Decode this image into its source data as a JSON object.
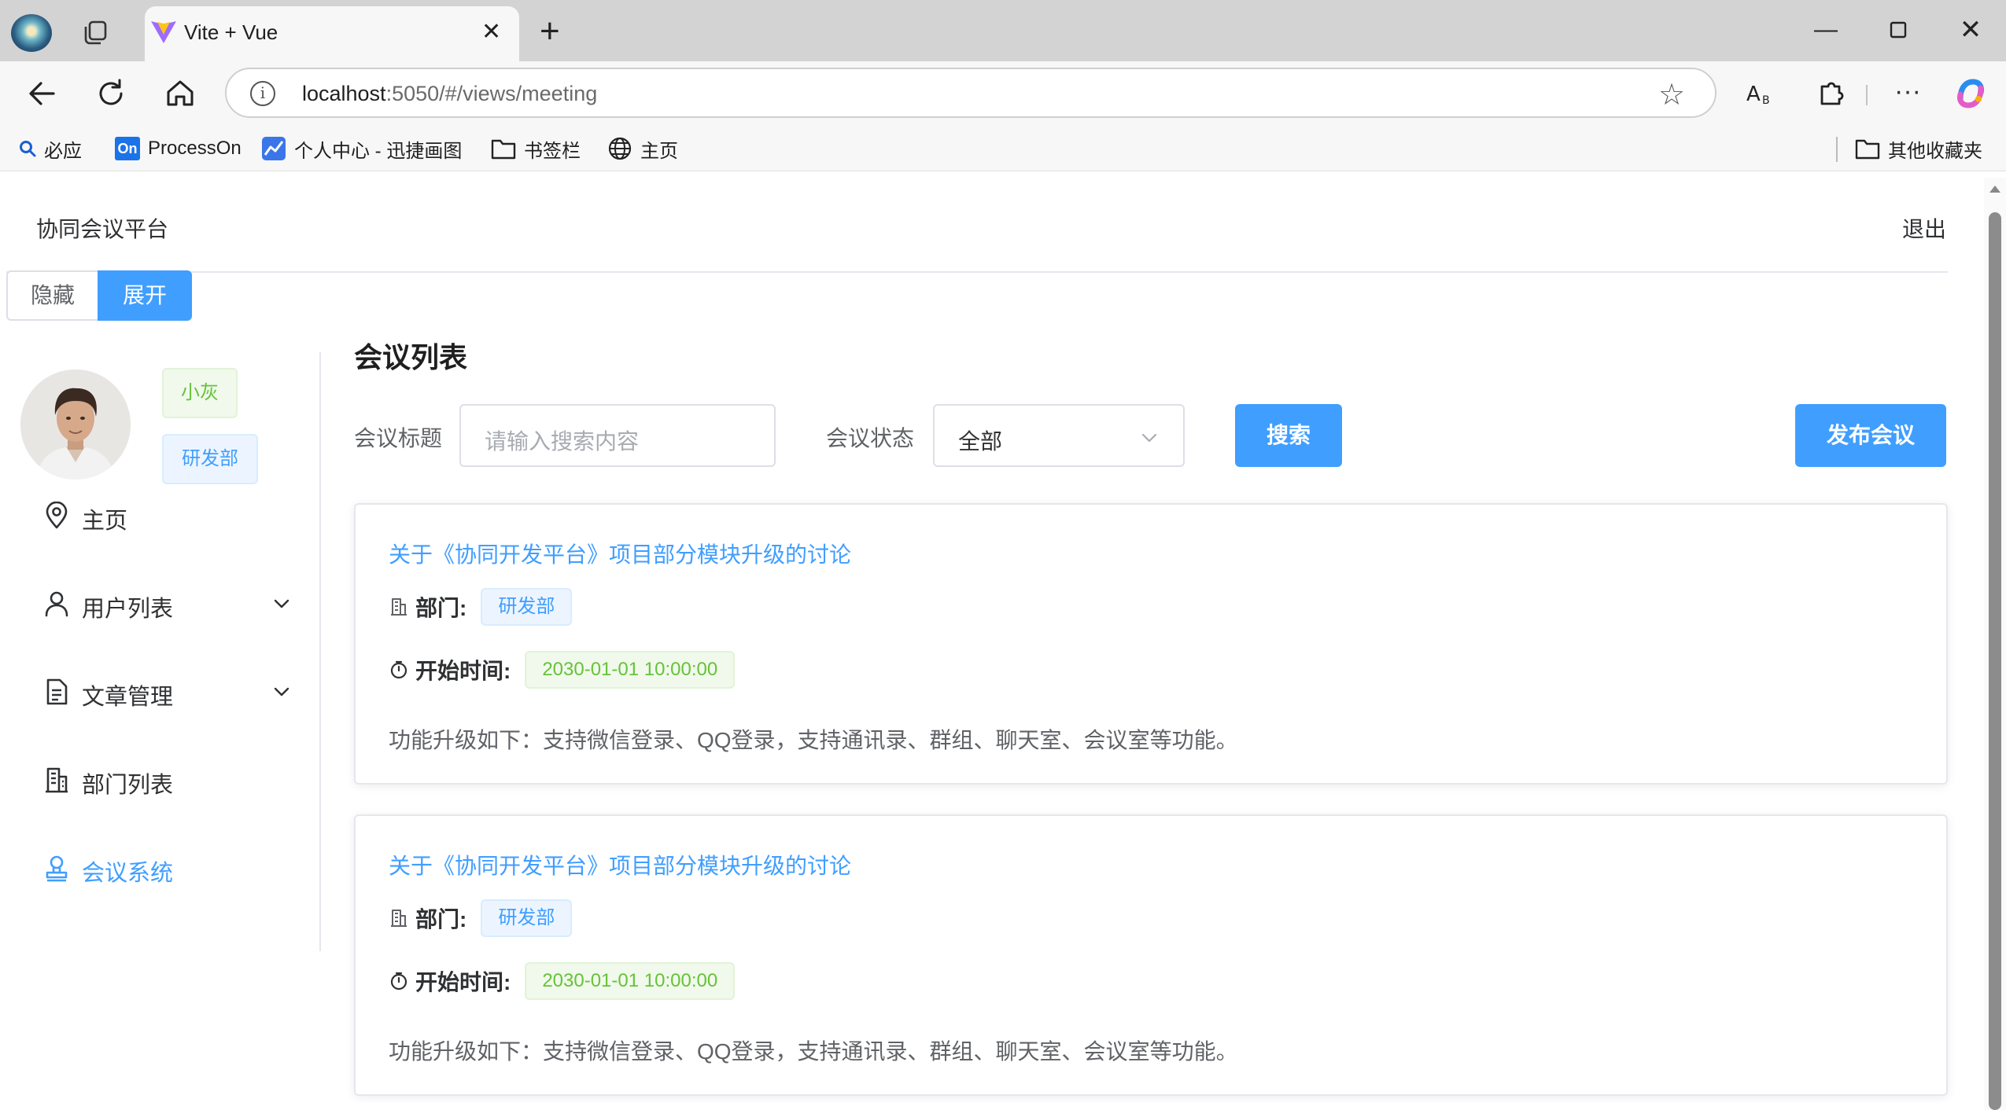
{
  "browser": {
    "tab_title": "Vite + Vue",
    "url_host": "localhost",
    "url_rest": ":5050/#/views/meeting",
    "bookmarks": [
      {
        "label": "必应",
        "icon": "search-icon"
      },
      {
        "label": "ProcessOn",
        "icon": "processon-icon"
      },
      {
        "label": "个人中心 - 迅捷画图",
        "icon": "chart-icon"
      },
      {
        "label": "书签栏",
        "icon": "folder-icon"
      },
      {
        "label": "主页",
        "icon": "globe-icon"
      }
    ],
    "other_bookmarks": "其他收藏夹"
  },
  "header": {
    "app_title": "协同会议平台",
    "logout": "退出"
  },
  "toggle": {
    "hide": "隐藏",
    "show": "展开"
  },
  "user": {
    "name": "小灰",
    "department": "研发部"
  },
  "sidebar": {
    "items": [
      {
        "label": "主页",
        "icon": "location-icon",
        "submenu": false
      },
      {
        "label": "用户列表",
        "icon": "user-icon",
        "submenu": true
      },
      {
        "label": "文章管理",
        "icon": "document-icon",
        "submenu": true
      },
      {
        "label": "部门列表",
        "icon": "office-building-icon",
        "submenu": false
      },
      {
        "label": "会议系统",
        "icon": "stamp-icon",
        "submenu": false,
        "active": true
      }
    ]
  },
  "main": {
    "title": "会议列表",
    "filter": {
      "title_label": "会议标题",
      "title_placeholder": "请输入搜索内容",
      "status_label": "会议状态",
      "status_value": "全部",
      "search_button": "搜索",
      "publish_button": "发布会议"
    },
    "meetings": [
      {
        "title": "关于《协同开发平台》项目部分模块升级的讨论",
        "dept_label": "部门:",
        "dept": "研发部",
        "time_label": "开始时间:",
        "start_time": "2030-01-01 10:00:00",
        "description": "功能升级如下：支持微信登录、QQ登录，支持通讯录、群组、聊天室、会议室等功能。"
      },
      {
        "title": "关于《协同开发平台》项目部分模块升级的讨论",
        "dept_label": "部门:",
        "dept": "研发部",
        "time_label": "开始时间:",
        "start_time": "2030-01-01 10:00:00",
        "description": "功能升级如下：支持微信登录、QQ登录，支持通讯录、群组、聊天室、会议室等功能。"
      }
    ]
  },
  "colors": {
    "primary": "#409eff",
    "success": "#67c23a",
    "border": "#dcdfe6"
  }
}
